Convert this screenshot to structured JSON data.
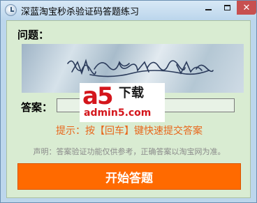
{
  "window": {
    "title": "深蓝淘宝秒杀验证码答题练习"
  },
  "form": {
    "question_label": "问题：",
    "answer_label": "答案：",
    "answer_value": "",
    "hint": "提示：按【回车】键快速提交答案",
    "disclaimer": "声明：答案验证功能仅供参考，正确答案以淘宝网为准。",
    "start_button": "开始答题"
  },
  "watermark": {
    "brand": "a5",
    "brand_suffix": "下载",
    "url": "admin5.com"
  },
  "icons": {
    "app": "clock-icon",
    "minimize": "minimize-icon",
    "maximize": "maximize-icon",
    "close": "close-icon"
  },
  "colors": {
    "start_button": "#ff6a00",
    "hint_text": "#e8661a",
    "client_bg": "#d9ecd2",
    "close_button": "#c75050",
    "watermark_red": "#d4161c"
  }
}
